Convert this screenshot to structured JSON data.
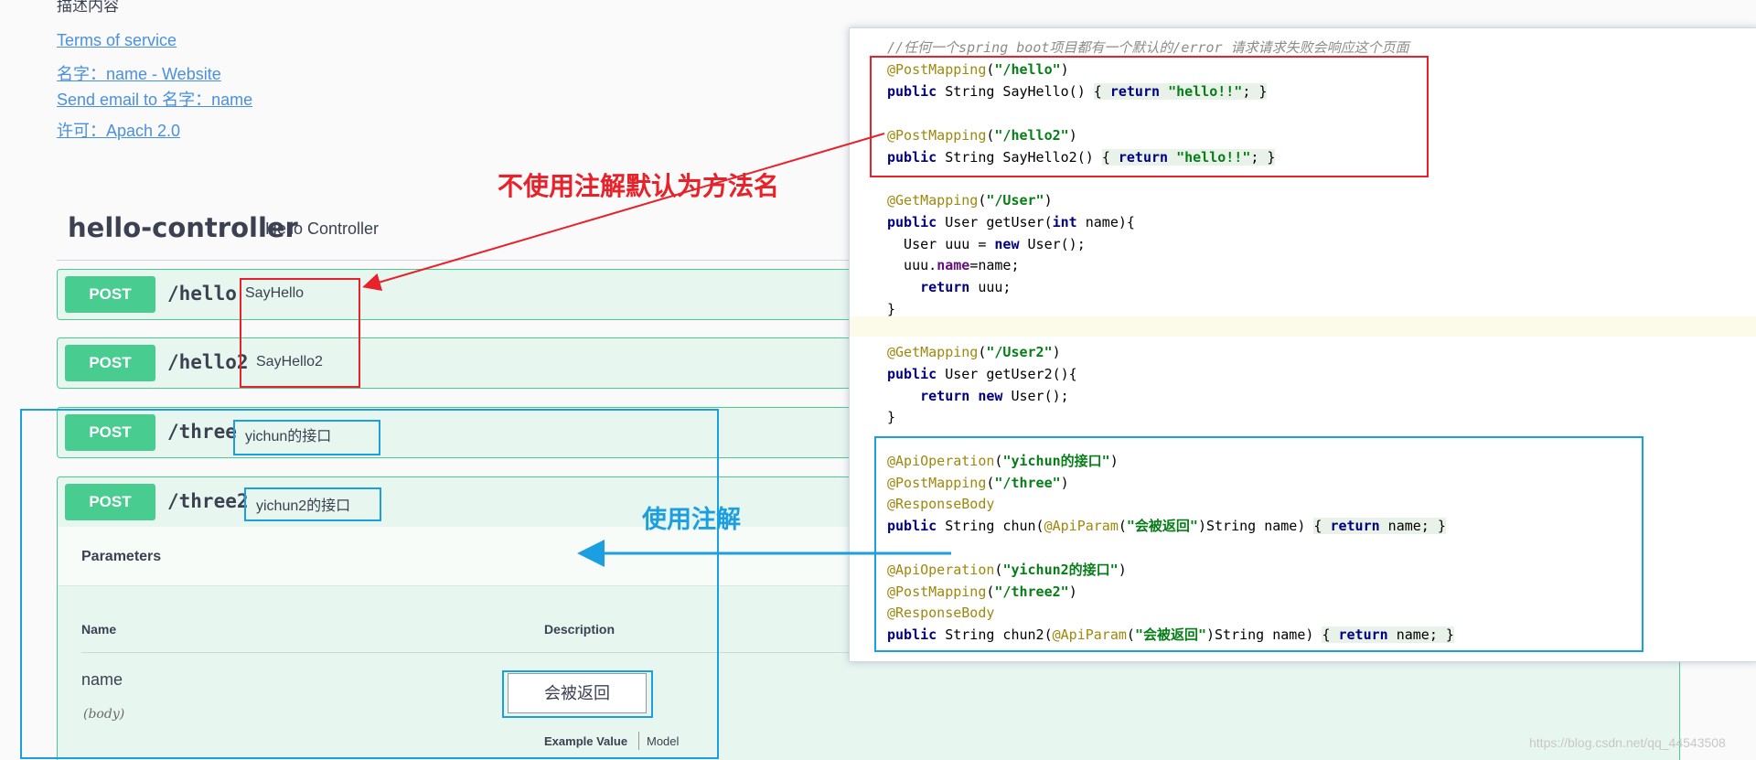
{
  "info": {
    "description_label": "描述内容",
    "terms_link": "Terms of service",
    "contact_website_link": "名字：name - Website",
    "contact_email_link": "Send email to 名字：name",
    "license_link": "许可：Apach 2.0"
  },
  "controller": {
    "title": "hello-controller",
    "description": "Hello Controller"
  },
  "operations": [
    {
      "method": "POST",
      "path": "/hello",
      "summary": "SayHello"
    },
    {
      "method": "POST",
      "path": "/hello2",
      "summary": "SayHello2"
    },
    {
      "method": "POST",
      "path": "/three",
      "summary": "yichun的接口"
    },
    {
      "method": "POST",
      "path": "/three2",
      "summary": "yichun2的接口"
    }
  ],
  "parameters": {
    "title": "Parameters",
    "col_name": "Name",
    "col_description": "Description",
    "param_name": "name",
    "param_type": "(body)",
    "param_description": "会被返回",
    "example_value_tab": "Example Value",
    "model_tab": "Model"
  },
  "code": {
    "comment": "//任何一个spring boot项目都有一个默认的/error 请求请求失败会响应这个页面",
    "l1_ann": "@PostMapping",
    "l1_str": "\"/hello\"",
    "l2_ret": "\"hello!!\"",
    "l3_ann": "@PostMapping",
    "l3_str": "\"/hello2\"",
    "l4_ret": "\"hello!!\"",
    "l5_ann": "@GetMapping",
    "l5_str": "\"/User\"",
    "l10_ann": "@GetMapping",
    "l10_str": "\"/User2\"",
    "l13_ann1": "@ApiOperation",
    "l13_str1": "\"yichun的接口\"",
    "l14_str": "\"/three\"",
    "l15_ann": "@ResponseBody",
    "l16_str": "\"会被返回\"",
    "l17_str": "\"yichun2的接口\"",
    "l18_str": "\"/three2\"",
    "l20_str": "\"会被返回\""
  },
  "annotations": {
    "red_label": "不使用注解默认为方法名",
    "blue_label": "使用注解",
    "red_color": "#e8222a",
    "blue_color": "#1c9fe0"
  },
  "watermark": "https://blog.csdn.net/qq_44543508",
  "colors": {
    "post_green": "#49cc90",
    "link_blue": "#4990e2"
  }
}
